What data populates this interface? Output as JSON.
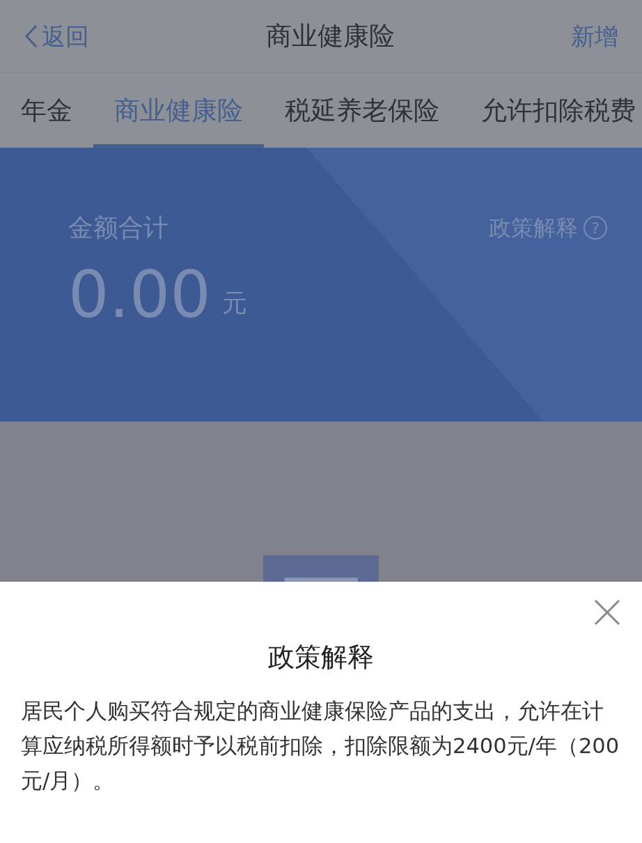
{
  "header": {
    "back": "返回",
    "title": "商业健康险",
    "action": "新增"
  },
  "tabs": [
    {
      "label": "年金",
      "selected": false
    },
    {
      "label": "商业健康险",
      "selected": true
    },
    {
      "label": "税延养老保险",
      "selected": false
    },
    {
      "label": "允许扣除税费",
      "selected": false
    }
  ],
  "summary": {
    "label": "金额合计",
    "amount": "0.00",
    "unit": "元",
    "policy_link": "政策解释",
    "help_icon": "?"
  },
  "sheet": {
    "title": "政策解释",
    "body": "居民个人购买符合规定的商业健康保险产品的支出，允许在计算应纳税所得额时予以税前扣除，扣除限额为2400元/年（200元/月）。"
  }
}
